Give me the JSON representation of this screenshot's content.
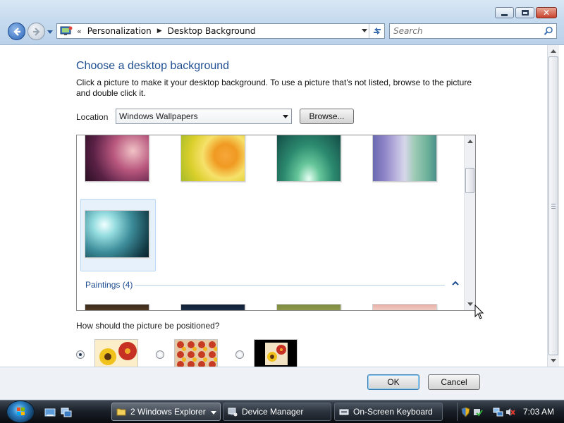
{
  "window": {
    "breadcrumb": [
      "Personalization",
      "Desktop Background"
    ],
    "search_placeholder": "Search"
  },
  "content": {
    "title": "Choose a desktop background",
    "description": "Click a picture to make it your desktop background. To use a picture that's not listed, browse to the picture and double click it.",
    "location_label": "Location",
    "location_value": "Windows Wallpapers",
    "browse_label": "Browse...",
    "group_label": "Paintings (4)",
    "position_question": "How should the picture be positioned?",
    "position_options": [
      "fit",
      "tile",
      "center"
    ],
    "position_selected": "fit"
  },
  "buttons": {
    "ok": "OK",
    "cancel": "Cancel"
  },
  "taskbar": {
    "items": [
      {
        "label": "2 Windows Explorer",
        "icon": "folder-icon",
        "active": true
      },
      {
        "label": "Device Manager",
        "icon": "device-manager-icon",
        "active": false
      },
      {
        "label": "On-Screen Keyboard",
        "icon": "keyboard-icon",
        "active": false
      }
    ],
    "clock": "7:03 AM"
  }
}
